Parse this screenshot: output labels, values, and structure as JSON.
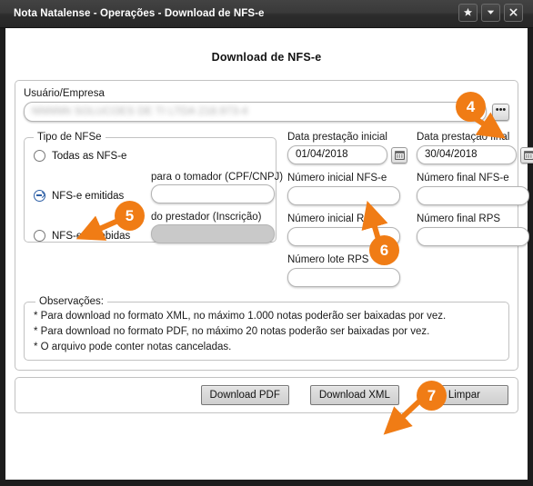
{
  "window": {
    "title": "Nota Natalense - Operações - Download de NFS-e",
    "controls": {
      "favorite": "favorite-star",
      "menu": "chevron-down",
      "close": "close"
    }
  },
  "page": {
    "heading": "Download de NFS-e"
  },
  "user": {
    "label": "Usuário/Empresa",
    "value": "NNNNN SOLUCOES DE TI LTDA 218.973-4",
    "redacted": true,
    "browse_label": "•••"
  },
  "tipo": {
    "legend": "Tipo de NFSe",
    "options": [
      {
        "label": "Todas as NFS-e",
        "selected": false
      },
      {
        "label": "NFS-e emitidas",
        "selected": true
      },
      {
        "label": "NFS-e recebidas",
        "selected": false
      }
    ],
    "tomador": {
      "label": "para o tomador (CPF/CNPJ)",
      "value": "",
      "disabled": false
    },
    "prestador": {
      "label": "do prestador (Inscrição)",
      "value": "",
      "disabled": true
    }
  },
  "filters": {
    "data_inicial": {
      "label": "Data prestação inicial",
      "value": "01/04/2018"
    },
    "data_final": {
      "label": "Data prestação final",
      "value": "30/04/2018"
    },
    "num_inicial_nfse": {
      "label": "Número inicial NFS-e",
      "value": ""
    },
    "num_final_nfse": {
      "label": "Número final NFS-e",
      "value": ""
    },
    "num_inicial_rps": {
      "label": "Número inicial RPS",
      "value": ""
    },
    "num_final_rps": {
      "label": "Número final RPS",
      "value": ""
    },
    "num_lote_rps": {
      "label": "Número lote RPS",
      "value": ""
    },
    "calendar_icon": "calendar-icon"
  },
  "observacoes": {
    "legend": "Observações:",
    "lines": [
      "* Para download no formato XML, no máximo 1.000 notas poderão ser baixadas por vez.",
      "* Para download no formato PDF, no máximo 20 notas poderão ser baixadas por vez.",
      "* O arquivo pode conter notas canceladas."
    ]
  },
  "actions": {
    "download_pdf": "Download PDF",
    "download_xml": "Download XML",
    "limpar": "Limpar"
  },
  "callouts": {
    "accent_color": "#f07c15",
    "items": [
      {
        "number": "4",
        "target": "browse-button"
      },
      {
        "number": "5",
        "target": "radio-nfse-emitidas"
      },
      {
        "number": "6",
        "target": "calendar-button-data-inicial"
      },
      {
        "number": "7",
        "target": "download-xml-button"
      }
    ]
  }
}
